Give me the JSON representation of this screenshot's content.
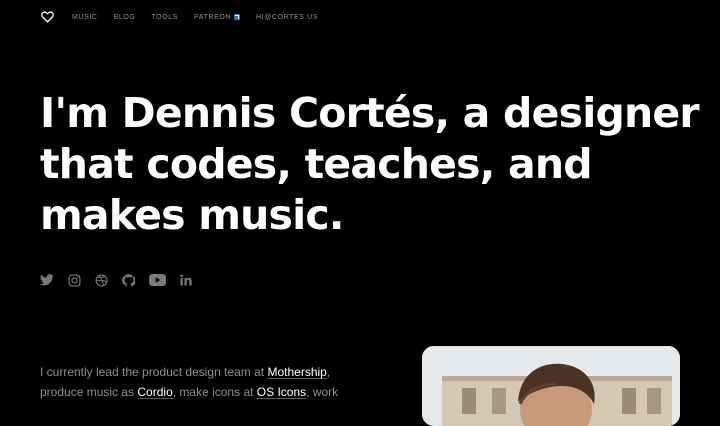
{
  "nav": {
    "logo_icon": "heart-outline-icon",
    "links": [
      {
        "label": "MUSIC"
      },
      {
        "label": "BLOG"
      },
      {
        "label": "TOOLS"
      },
      {
        "label": "PATREON",
        "badge_icon": "external-link-icon"
      },
      {
        "label": "HI@CORTES.US"
      }
    ]
  },
  "hero": {
    "title": "I'm Dennis Cortés, a designer that codes, teaches, and makes music."
  },
  "social": [
    {
      "icon": "twitter-icon"
    },
    {
      "icon": "instagram-icon"
    },
    {
      "icon": "dribbble-icon"
    },
    {
      "icon": "github-icon"
    },
    {
      "icon": "youtube-icon"
    },
    {
      "icon": "linkedin-icon"
    }
  ],
  "bio": {
    "t1": "I currently lead the product design team at ",
    "l1": "Mothership",
    "t2": ", produce music as ",
    "l2": "Cordio",
    "t3": ", make icons at ",
    "l3": "OS Icons",
    "t4": ", work"
  },
  "colors": {
    "background": "#000000",
    "heading": "#ffffff",
    "nav_text": "#8f8f8f",
    "icon": "#7a7a7a",
    "body_text": "#8e8e8e",
    "link": "#ffffff",
    "patreon_badge": "#2f6fd1"
  }
}
